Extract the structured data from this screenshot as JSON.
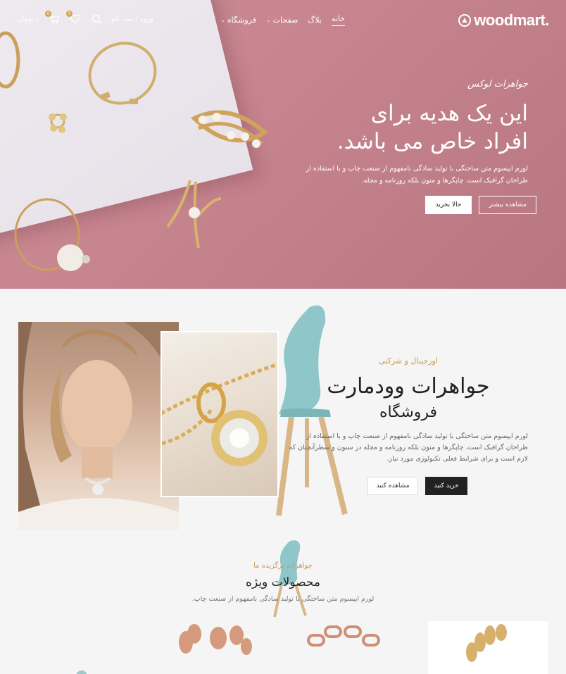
{
  "brand": {
    "name": "woodmart."
  },
  "nav": {
    "items": [
      {
        "label": "خانه",
        "active": true,
        "dropdown": false
      },
      {
        "label": "بلاگ",
        "active": false,
        "dropdown": false
      },
      {
        "label": "صفحات",
        "active": false,
        "dropdown": true
      },
      {
        "label": "فروشگاه",
        "active": false,
        "dropdown": true
      }
    ]
  },
  "header_tools": {
    "login_label": "ورود / ثبت نام",
    "wishlist_count": "0",
    "cart_count": "0",
    "cart_total": "٠ تومان",
    "icons": [
      "search-icon",
      "heart-icon",
      "cart-icon"
    ]
  },
  "hero": {
    "subtitle": "جواهرات لوکس",
    "title_line1": "این یک هدیه برای",
    "title_line2": "افراد خاص می باشد.",
    "description": "لورم ایپسوم متن ساختگی با تولید سادگی نامفهوم از صنعت چاپ و با استفاده از طراحان گرافیک است. چاپگرها و متون بلکه روزنامه و مجله.",
    "btn_more": "مشاهده بیشتر",
    "btn_buy": "حالا بخرید",
    "bg_color": "#c98c95"
  },
  "about": {
    "tag": "اورجینال و شرکتی",
    "title": "جواهرات وودمارت",
    "subtitle": "فروشگاه",
    "description": "لورم ایپسوم متن ساختگی با تولید سادگی نامفهوم از صنعت چاپ و با استفاده از طراحان گرافیک است. چاپگرها و متون بلکه روزنامه و مجله در ستون و سطرآنچنان که لازم است و برای شرایط فعلی تکنولوژی مورد نیاز.",
    "btn_buy": "خرید کنید",
    "btn_view": "مشاهده کنید"
  },
  "featured": {
    "tag": "جواهرات برگزیده ما",
    "title": "محصولات ویژه",
    "description": "لورم ایپسوم متن ساختگی با تولید سادگی نامفهوم از صنعت چاپ."
  },
  "colors": {
    "accent": "#c29b4c",
    "dark": "#222222",
    "hero_pink": "#c98c95"
  }
}
